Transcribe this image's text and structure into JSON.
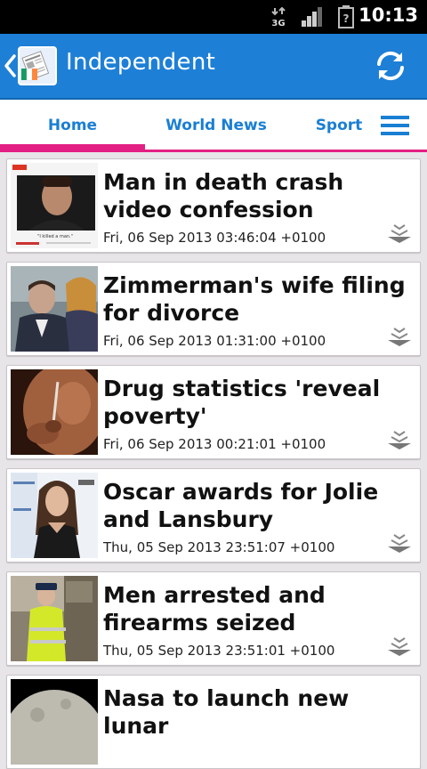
{
  "status_bar": {
    "network": "3G",
    "time": "10:13"
  },
  "action_bar": {
    "title": "Independent",
    "logo_icon": "newspaper-ireland-flag-icon",
    "refresh_icon": "refresh-icon"
  },
  "tabs": [
    {
      "label": "Home",
      "selected": true
    },
    {
      "label": "World News",
      "selected": false
    },
    {
      "label": "Sport",
      "selected": false
    }
  ],
  "colors": {
    "accent_blue": "#1e7fd6",
    "tab_text": "#1a7fd4",
    "tab_indicator": "#e21f83"
  },
  "articles": [
    {
      "headline": "Man in death crash video confession",
      "date": "Fri, 06 Sep 2013 03:46:04 +0100",
      "thumb_caption": "\"I killed a man.\""
    },
    {
      "headline": "Zimmerman's wife filing for divorce",
      "date": "Fri, 06 Sep 2013 01:31:00 +0100"
    },
    {
      "headline": "Drug statistics 'reveal poverty'",
      "date": "Fri, 06 Sep 2013 00:21:01 +0100"
    },
    {
      "headline": "Oscar awards for Jolie and Lansbury",
      "date": "Thu, 05 Sep 2013 23:51:07 +0100"
    },
    {
      "headline": "Men arrested and firearms seized",
      "date": "Thu, 05 Sep 2013 23:51:01 +0100"
    },
    {
      "headline": "Nasa to launch new lunar"
    }
  ]
}
